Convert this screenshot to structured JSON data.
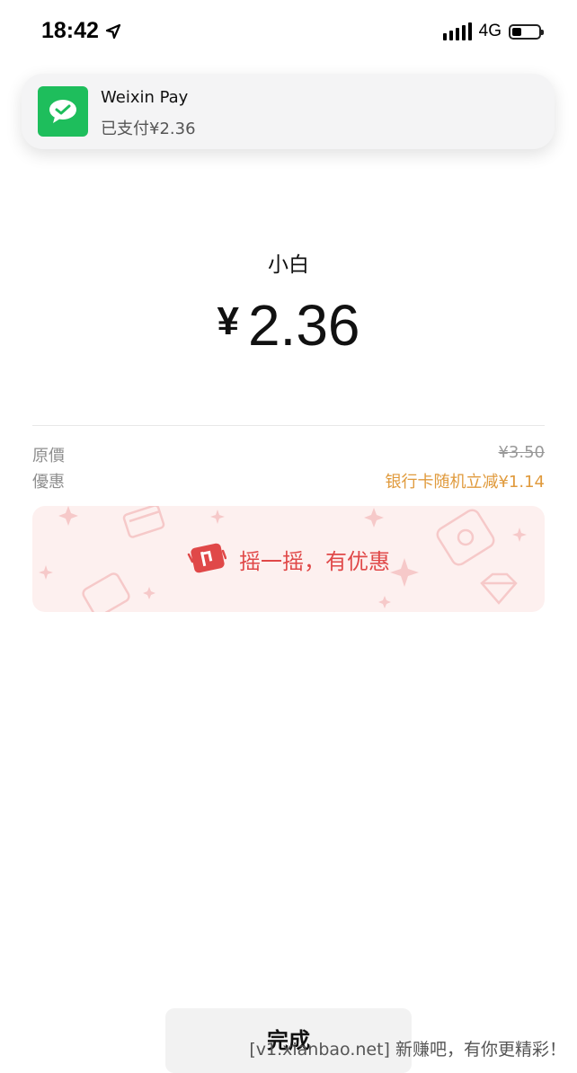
{
  "status_bar": {
    "time": "18:42",
    "network": "4G",
    "battery_level": 0.35,
    "icons": [
      "location-arrow-icon",
      "signal-icon",
      "battery-icon"
    ]
  },
  "notification": {
    "app_name": "Weixin Pay",
    "message": "已支付¥2.36",
    "icon": "wechat-icon",
    "accent_color": "#1ebe5c"
  },
  "payment": {
    "merchant": "小白",
    "currency_symbol": "¥",
    "amount": "2.36"
  },
  "details": {
    "original_label": "原價",
    "original_value": "¥3.50",
    "discount_label": "優惠",
    "discount_value": "银行卡随机立减¥1.14",
    "discount_color": "#e09a3c"
  },
  "shake_banner": {
    "text": "摇一摇，有优惠",
    "icon": "shake-phone-icon",
    "text_color": "#e04848",
    "background_color": "#fdf0ef"
  },
  "done_button": {
    "label": "完成"
  },
  "watermark": {
    "text": "[v1.xianbao.net] 新赚吧，有你更精彩！"
  }
}
